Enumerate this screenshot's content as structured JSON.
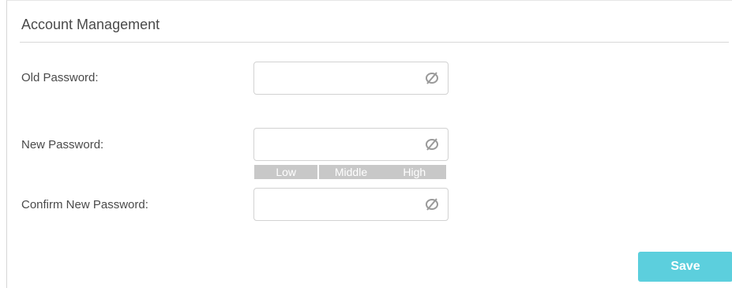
{
  "section": {
    "title": "Account Management"
  },
  "fields": {
    "old_password": {
      "label": "Old Password:",
      "value": ""
    },
    "new_password": {
      "label": "New Password:",
      "value": ""
    },
    "confirm_password": {
      "label": "Confirm New Password:",
      "value": ""
    }
  },
  "strength_meter": {
    "levels": [
      "Low",
      "Middle",
      "High"
    ]
  },
  "icons": {
    "toggle_visibility": "eye-slash-icon"
  },
  "colors": {
    "accent": "#5ccfdd",
    "meter_bg": "#c8c8c8"
  },
  "actions": {
    "save_label": "Save"
  }
}
